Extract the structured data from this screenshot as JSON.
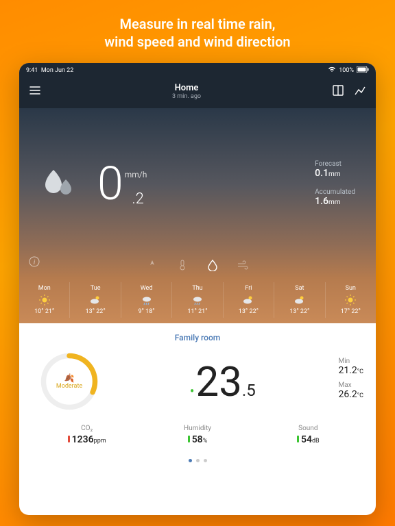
{
  "tagline": "Measure in real time rain,\nwind speed and wind direction",
  "statusBar": {
    "time": "9:41",
    "date": "Mon Jun 22",
    "batteryPct": "100%"
  },
  "topBar": {
    "title": "Home",
    "subtitle": "3 min. ago"
  },
  "hero": {
    "rain": {
      "big": "0",
      "frac": ".2",
      "unit": "mm/h"
    },
    "forecast": {
      "label": "Forecast",
      "value": "0.1",
      "unit": "mm"
    },
    "accumulated": {
      "label": "Accumulated",
      "value": "1.6",
      "unit": "mm"
    }
  },
  "week": [
    {
      "day": "Mon",
      "icon": "sun",
      "lo": "10°",
      "hi": "21°"
    },
    {
      "day": "Tue",
      "icon": "cloud-sun",
      "lo": "13°",
      "hi": "22°"
    },
    {
      "day": "Wed",
      "icon": "cloud-rain",
      "lo": "9°",
      "hi": "18°"
    },
    {
      "day": "Thu",
      "icon": "cloud-rain",
      "lo": "11°",
      "hi": "21°"
    },
    {
      "day": "Fri",
      "icon": "cloud-sun",
      "lo": "13°",
      "hi": "22°"
    },
    {
      "day": "Sat",
      "icon": "cloud-sun",
      "lo": "13°",
      "hi": "22°"
    },
    {
      "day": "Sun",
      "icon": "sun",
      "lo": "17°",
      "hi": "22°"
    }
  ],
  "room": {
    "name": "Family room",
    "gauge": {
      "level": "Moderate",
      "color": "#f0b420"
    },
    "temp": {
      "big": "23",
      "frac": ".5"
    },
    "min": {
      "label": "Min",
      "value": "21.2",
      "unit": "°C"
    },
    "max": {
      "label": "Max",
      "value": "26.2",
      "unit": "°C"
    },
    "co2": {
      "label": "CO₂",
      "value": "1236",
      "unit": "ppm",
      "barColor": "red"
    },
    "humidity": {
      "label": "Humidity",
      "value": "58",
      "unit": "%",
      "barColor": "green"
    },
    "sound": {
      "label": "Sound",
      "value": "54",
      "unit": "dB",
      "barColor": "green"
    }
  }
}
